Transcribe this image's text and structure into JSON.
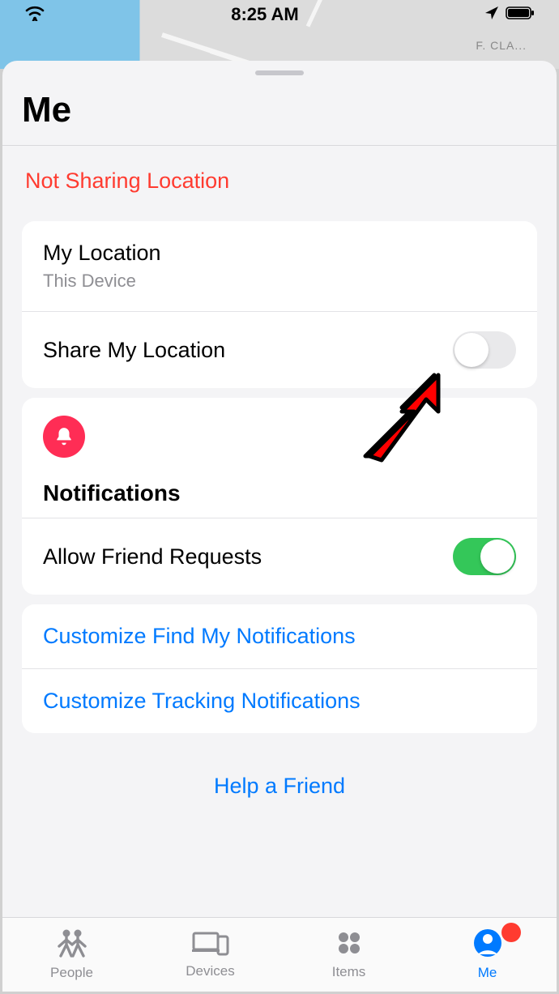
{
  "status_bar": {
    "time": "8:25 AM"
  },
  "sheet": {
    "title": "Me",
    "sharing_status": "Not Sharing Location"
  },
  "location_card": {
    "my_location_label": "My Location",
    "my_location_value": "This Device",
    "share_label": "Share My Location",
    "share_on": false
  },
  "notifications_card": {
    "section_title": "Notifications",
    "allow_label": "Allow Friend Requests",
    "allow_on": true
  },
  "links_card": {
    "customize_findmy": "Customize Find My Notifications",
    "customize_tracking": "Customize Tracking Notifications"
  },
  "help_link": "Help a Friend",
  "tabs": {
    "people": "People",
    "devices": "Devices",
    "items": "Items",
    "me": "Me"
  },
  "colors": {
    "link": "#007aff",
    "danger": "#ff3b30",
    "pink": "#ff2d55",
    "green": "#34c759"
  }
}
